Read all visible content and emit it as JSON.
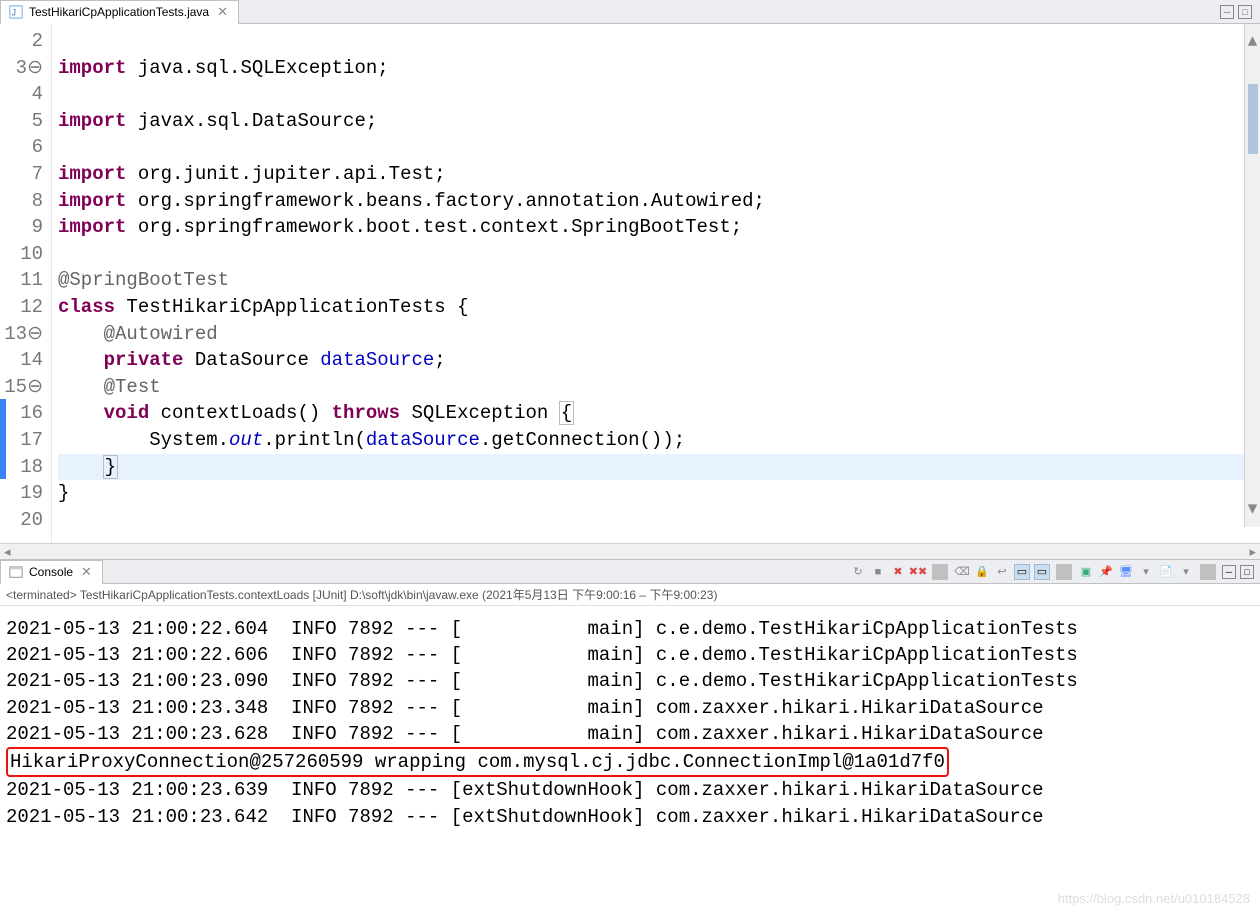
{
  "editor": {
    "tab": {
      "filename": "TestHikariCpApplicationTests.java"
    },
    "lines": [
      {
        "num": "2",
        "marker": "",
        "tokens": []
      },
      {
        "num": "3",
        "marker": "⊖",
        "tokens": [
          [
            "kw",
            "import"
          ],
          [
            "",
            " java.sql.SQLException;"
          ]
        ]
      },
      {
        "num": "4",
        "marker": "",
        "tokens": []
      },
      {
        "num": "5",
        "marker": "",
        "tokens": [
          [
            "kw",
            "import"
          ],
          [
            "",
            " javax.sql.DataSource;"
          ]
        ]
      },
      {
        "num": "6",
        "marker": "",
        "tokens": []
      },
      {
        "num": "7",
        "marker": "",
        "tokens": [
          [
            "kw",
            "import"
          ],
          [
            "",
            " org.junit.jupiter.api.Test;"
          ]
        ]
      },
      {
        "num": "8",
        "marker": "",
        "tokens": [
          [
            "kw",
            "import"
          ],
          [
            "",
            " org.springframework.beans.factory.annotation.Autowired;"
          ]
        ]
      },
      {
        "num": "9",
        "marker": "",
        "tokens": [
          [
            "kw",
            "import"
          ],
          [
            "",
            " org.springframework.boot.test.context.SpringBootTest;"
          ]
        ]
      },
      {
        "num": "10",
        "marker": "",
        "tokens": []
      },
      {
        "num": "11",
        "marker": "",
        "tokens": [
          [
            "ann",
            "@SpringBootTest"
          ]
        ]
      },
      {
        "num": "12",
        "marker": "",
        "tokens": [
          [
            "kw",
            "class"
          ],
          [
            "",
            " TestHikariCpApplicationTests {"
          ]
        ]
      },
      {
        "num": "13",
        "marker": "⊖",
        "tokens": [
          [
            "",
            "    "
          ],
          [
            "ann",
            "@Autowired"
          ]
        ]
      },
      {
        "num": "14",
        "marker": "",
        "tokens": [
          [
            "",
            "    "
          ],
          [
            "kw",
            "private"
          ],
          [
            "",
            " DataSource "
          ],
          [
            "field",
            "dataSource"
          ],
          [
            "",
            ";"
          ]
        ]
      },
      {
        "num": "15",
        "marker": "⊖",
        "tokens": [
          [
            "",
            "    "
          ],
          [
            "ann",
            "@Test"
          ]
        ]
      },
      {
        "num": "16",
        "marker": "",
        "tokens": [
          [
            "",
            "    "
          ],
          [
            "kw",
            "void"
          ],
          [
            "",
            " contextLoads() "
          ],
          [
            "kw",
            "throws"
          ],
          [
            "",
            " SQLException "
          ],
          [
            "boxed",
            "{"
          ]
        ]
      },
      {
        "num": "17",
        "marker": "",
        "tokens": [
          [
            "",
            "        System."
          ],
          [
            "staticf",
            "out"
          ],
          [
            "",
            ".println("
          ],
          [
            "field",
            "dataSource"
          ],
          [
            "",
            ".getConnection());"
          ]
        ]
      },
      {
        "num": "18",
        "marker": "",
        "hl": true,
        "tokens": [
          [
            "",
            "    "
          ],
          [
            "boxed",
            "}"
          ]
        ]
      },
      {
        "num": "19",
        "marker": "",
        "tokens": [
          [
            "",
            "}"
          ]
        ]
      },
      {
        "num": "20",
        "marker": "",
        "tokens": []
      }
    ]
  },
  "console": {
    "tab_label": "Console",
    "terminated": "<terminated> TestHikariCpApplicationTests.contextLoads [JUnit] D:\\soft\\jdk\\bin\\javaw.exe  (2021年5月13日 下午9:00:16 – 下午9:00:23)",
    "log_lines": [
      "2021-05-13 21:00:22.604  INFO 7892 --- [           main] c.e.demo.TestHikariCpApplicationTests",
      "2021-05-13 21:00:22.606  INFO 7892 --- [           main] c.e.demo.TestHikariCpApplicationTests",
      "2021-05-13 21:00:23.090  INFO 7892 --- [           main] c.e.demo.TestHikariCpApplicationTests",
      "2021-05-13 21:00:23.348  INFO 7892 --- [           main] com.zaxxer.hikari.HikariDataSource",
      "2021-05-13 21:00:23.628  INFO 7892 --- [           main] com.zaxxer.hikari.HikariDataSource"
    ],
    "highlight_line": "HikariProxyConnection@257260599 wrapping com.mysql.cj.jdbc.ConnectionImpl@1a01d7f0",
    "log_lines_after": [
      "2021-05-13 21:00:23.639  INFO 7892 --- [extShutdownHook] com.zaxxer.hikari.HikariDataSource",
      "2021-05-13 21:00:23.642  INFO 7892 --- [extShutdownHook] com.zaxxer.hikari.HikariDataSource"
    ]
  },
  "watermark": "https://blog.csdn.net/u010184528"
}
